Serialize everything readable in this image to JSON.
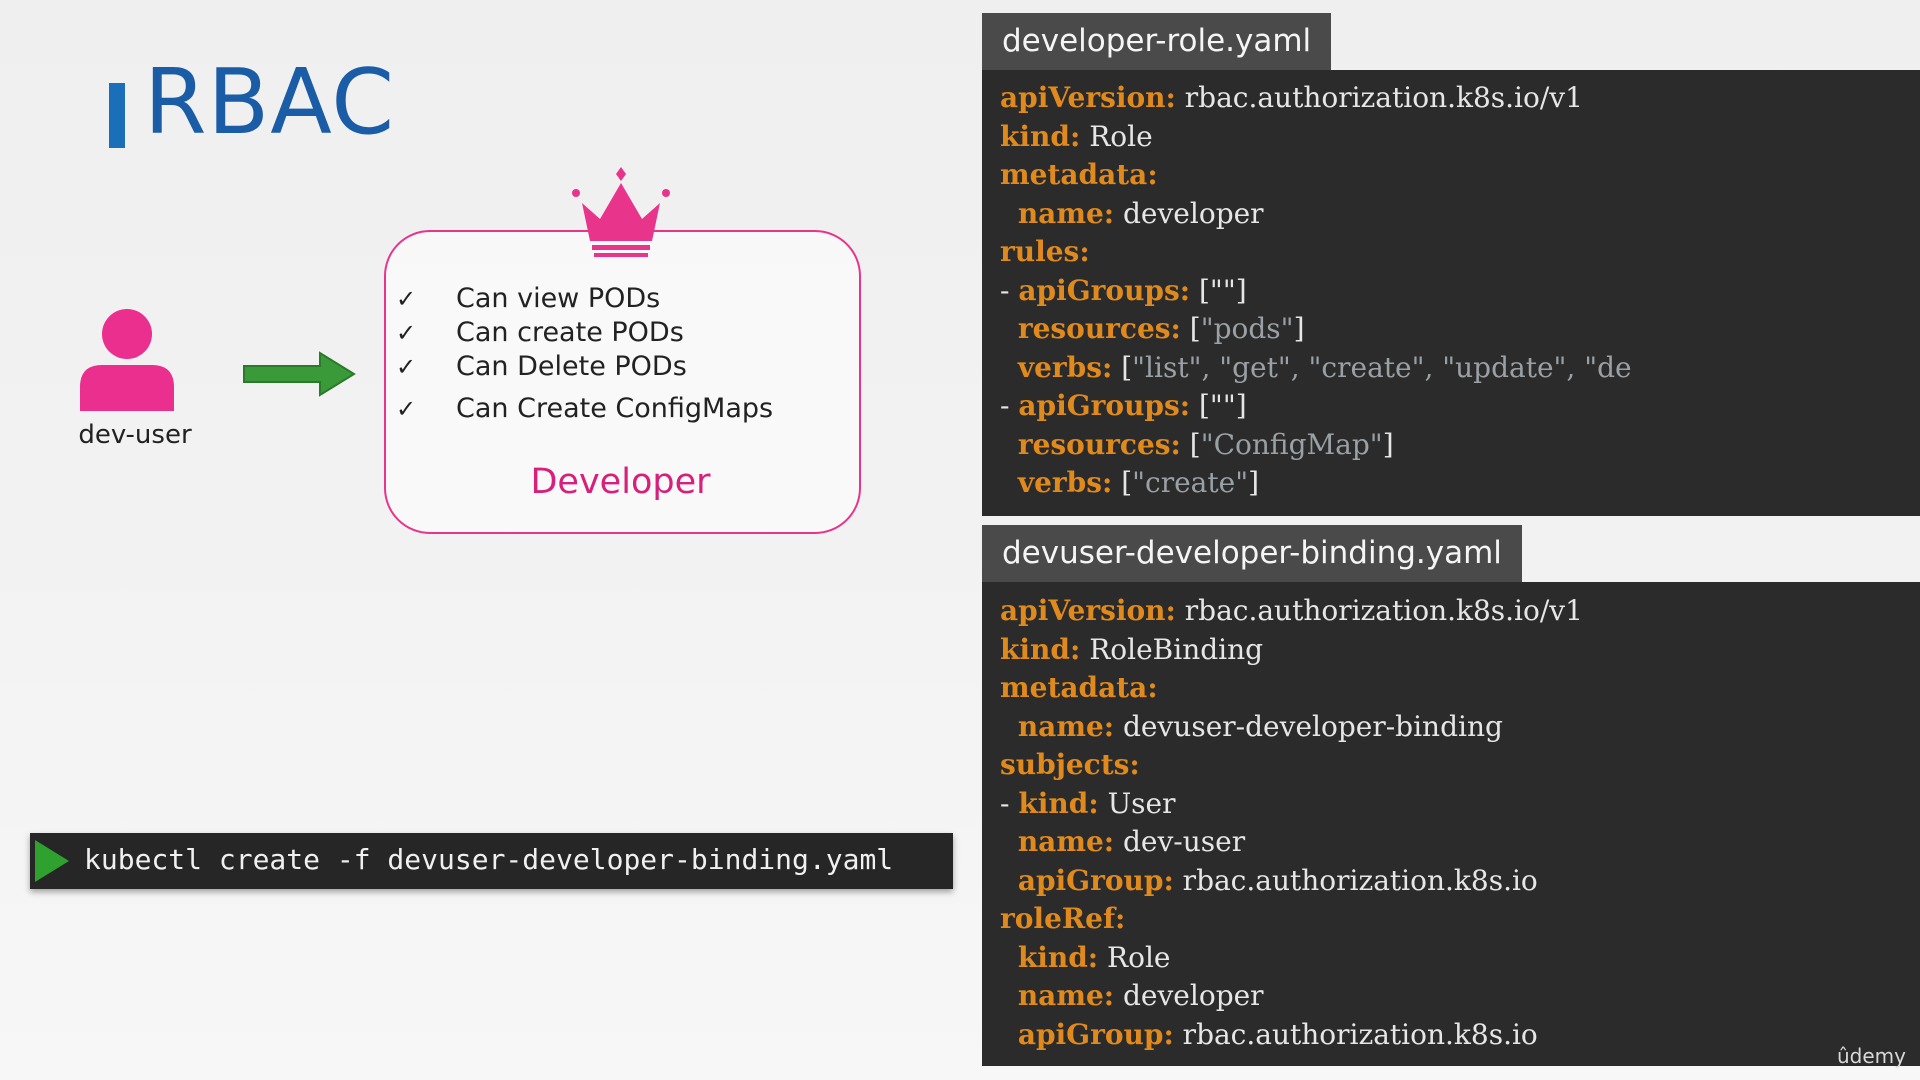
{
  "slide": {
    "title": "RBAC",
    "user_label": "dev-user",
    "role_name": "Developer",
    "permissions": [
      "Can view PODs",
      "Can create PODs",
      "Can Delete PODs",
      "Can Create ConfigMaps"
    ],
    "check_glyph": "✓"
  },
  "command": {
    "text": "kubectl create -f devuser-developer-binding.yaml"
  },
  "files": {
    "role": {
      "name": "developer-role.yaml",
      "lines": [
        [
          {
            "t": "k",
            "v": "apiVersion:"
          },
          {
            "t": "v",
            "v": " rbac.authorization.k8s.io/v1"
          }
        ],
        [
          {
            "t": "k",
            "v": "kind:"
          },
          {
            "t": "v",
            "v": " Role"
          }
        ],
        [
          {
            "t": "k",
            "v": "metadata:"
          }
        ],
        [
          {
            "t": "v",
            "v": "  "
          },
          {
            "t": "k",
            "v": "name:"
          },
          {
            "t": "v",
            "v": " developer"
          }
        ],
        [
          {
            "t": "k",
            "v": "rules:"
          }
        ],
        [
          {
            "t": "v",
            "v": "- "
          },
          {
            "t": "k",
            "v": "apiGroups:"
          },
          {
            "t": "v",
            "v": " [\"\"]"
          }
        ],
        [
          {
            "t": "v",
            "v": "  "
          },
          {
            "t": "k",
            "v": "resources:"
          },
          {
            "t": "v",
            "v": " ["
          },
          {
            "t": "s",
            "v": "\"pods\""
          },
          {
            "t": "v",
            "v": "]"
          }
        ],
        [
          {
            "t": "v",
            "v": "  "
          },
          {
            "t": "k",
            "v": "verbs:"
          },
          {
            "t": "v",
            "v": " ["
          },
          {
            "t": "s",
            "v": "\"list\", \"get\", \"create\", \"update\", \"de"
          }
        ],
        [
          {
            "t": "v",
            "v": "- "
          },
          {
            "t": "k",
            "v": "apiGroups:"
          },
          {
            "t": "v",
            "v": " [\"\"]"
          }
        ],
        [
          {
            "t": "v",
            "v": "  "
          },
          {
            "t": "k",
            "v": "resources:"
          },
          {
            "t": "v",
            "v": " ["
          },
          {
            "t": "s",
            "v": "\"ConfigMap\""
          },
          {
            "t": "v",
            "v": "]"
          }
        ],
        [
          {
            "t": "v",
            "v": "  "
          },
          {
            "t": "k",
            "v": "verbs:"
          },
          {
            "t": "v",
            "v": " ["
          },
          {
            "t": "s",
            "v": "\"create\""
          },
          {
            "t": "v",
            "v": "]"
          }
        ]
      ]
    },
    "binding": {
      "name": "devuser-developer-binding.yaml",
      "lines": [
        [
          {
            "t": "k",
            "v": "apiVersion:"
          },
          {
            "t": "v",
            "v": " rbac.authorization.k8s.io/v1"
          }
        ],
        [
          {
            "t": "k",
            "v": "kind:"
          },
          {
            "t": "v",
            "v": " RoleBinding"
          }
        ],
        [
          {
            "t": "k",
            "v": "metadata:"
          }
        ],
        [
          {
            "t": "v",
            "v": "  "
          },
          {
            "t": "k",
            "v": "name:"
          },
          {
            "t": "v",
            "v": " devuser-developer-binding"
          }
        ],
        [
          {
            "t": "k",
            "v": "subjects:"
          }
        ],
        [
          {
            "t": "v",
            "v": "- "
          },
          {
            "t": "k",
            "v": "kind:"
          },
          {
            "t": "v",
            "v": " User"
          }
        ],
        [
          {
            "t": "v",
            "v": "  "
          },
          {
            "t": "k",
            "v": "name:"
          },
          {
            "t": "v",
            "v": " dev-user"
          }
        ],
        [
          {
            "t": "v",
            "v": "  "
          },
          {
            "t": "k",
            "v": "apiGroup:"
          },
          {
            "t": "v",
            "v": " rbac.authorization.k8s.io"
          }
        ],
        [
          {
            "t": "k",
            "v": "roleRef:"
          }
        ],
        [
          {
            "t": "v",
            "v": "  "
          },
          {
            "t": "k",
            "v": "kind:"
          },
          {
            "t": "v",
            "v": " Role"
          }
        ],
        [
          {
            "t": "v",
            "v": "  "
          },
          {
            "t": "k",
            "v": "name:"
          },
          {
            "t": "v",
            "v": " developer"
          }
        ],
        [
          {
            "t": "v",
            "v": "  "
          },
          {
            "t": "k",
            "v": "apiGroup:"
          },
          {
            "t": "v",
            "v": " rbac.authorization.k8s.io"
          }
        ]
      ]
    }
  },
  "watermark": "ûdemy",
  "colors": {
    "title": "#1a5da6",
    "accent_pink": "#e8348a",
    "arrow_green": "#3a9a3a",
    "yaml_key": "#e08a1e",
    "code_bg": "#2b2b2b",
    "tab_bg": "#4a4a4a"
  },
  "icons": {
    "user": "user-silhouette-icon",
    "crown": "crown-icon",
    "arrow": "arrow-right-icon",
    "play": "play-triangle-icon"
  }
}
